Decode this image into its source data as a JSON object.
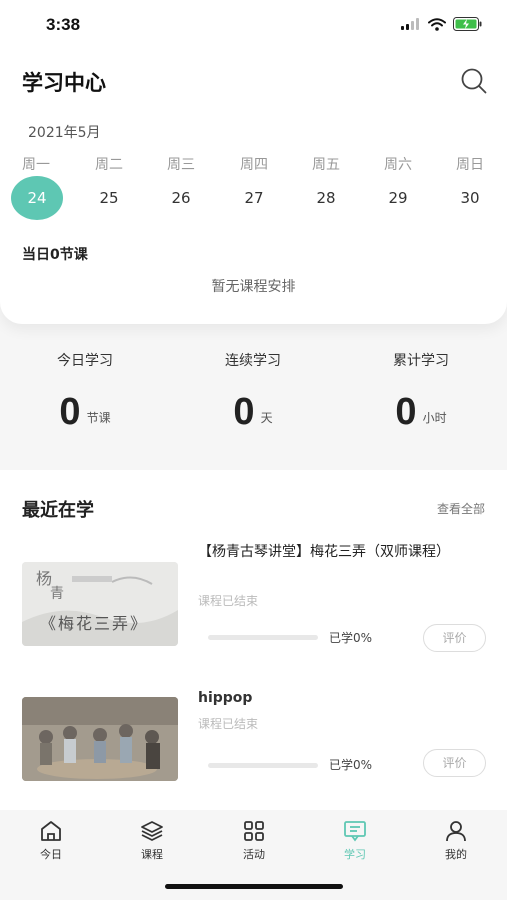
{
  "status_bar": {
    "time": "3:38"
  },
  "header": {
    "title": "学习中心"
  },
  "calendar": {
    "month": "2021年5月",
    "weekdays": [
      "周一",
      "周二",
      "周三",
      "周四",
      "周五",
      "周六",
      "周日"
    ],
    "dates": [
      "24",
      "25",
      "26",
      "27",
      "28",
      "29",
      "30"
    ],
    "selected_index": 0,
    "accent_color": "#5ec7b3"
  },
  "today": {
    "count_label": "当日0节课",
    "empty_text": "暂无课程安排"
  },
  "stats": [
    {
      "label": "今日学习",
      "value": "0",
      "unit": "节课"
    },
    {
      "label": "连续学习",
      "value": "0",
      "unit": "天"
    },
    {
      "label": "累计学习",
      "value": "0",
      "unit": "小时"
    }
  ],
  "recent": {
    "title": "最近在学",
    "view_all": "查看全部",
    "courses": [
      {
        "title": "【杨青古琴讲堂】梅花三弄（双师课程）",
        "thumb_text": "《梅花三弄》",
        "status": "课程已结束",
        "progress": 0,
        "progress_text": "已学0%",
        "rate_label": "评价"
      },
      {
        "title": "hippop",
        "status": "课程已结束",
        "progress": 0,
        "progress_text": "已学0%",
        "rate_label": "评价"
      }
    ]
  },
  "tabs": [
    {
      "label": "今日",
      "icon": "home-icon"
    },
    {
      "label": "课程",
      "icon": "layers-icon"
    },
    {
      "label": "活动",
      "icon": "grid-icon"
    },
    {
      "label": "学习",
      "icon": "study-icon",
      "active": true
    },
    {
      "label": "我的",
      "icon": "user-icon"
    }
  ]
}
